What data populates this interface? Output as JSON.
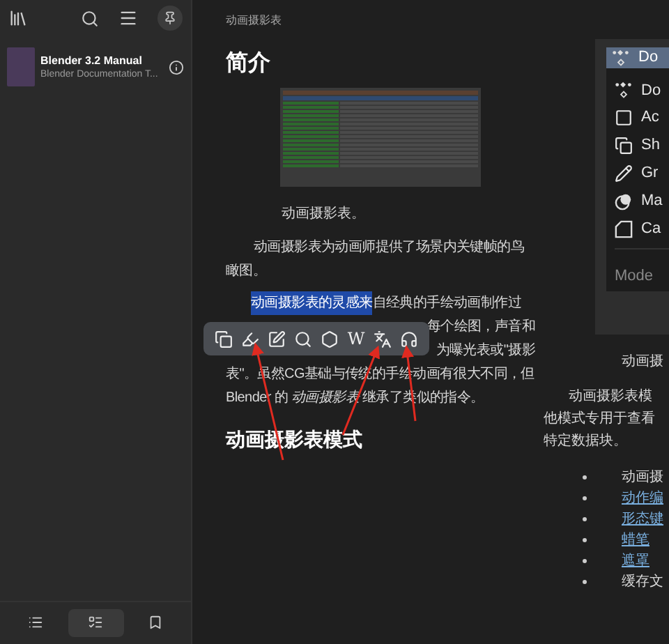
{
  "sidebar": {
    "book": {
      "title": "Blender 3.2 Manual",
      "subtitle": "Blender Documentation T..."
    },
    "bottom_tabs": [
      {
        "kind": "contents",
        "selected": false
      },
      {
        "kind": "notes",
        "selected": true
      },
      {
        "kind": "bookmarks",
        "selected": false
      }
    ]
  },
  "article": {
    "breadcrumb": "动画摄影表",
    "heading": "简介",
    "figure_caption": "动画摄影表。",
    "paragraph_1": "动画摄影表为动画师提供了场景内关键帧的鸟瞰图。",
    "paragraph_2": {
      "selected_text": "动画摄影表的灵感来",
      "line_1_rest": "自经典的手绘动画制作过",
      "line_2_visible": "每个绘图，声音和",
      "line_3_visible": "为曝光表或\"摄影",
      "line_4": "表\"。虽然CG基础与传统的手绘动画有很大不同，但",
      "line_5": "Blender 的 *动画摄影表* 继承了类似的指令。"
    },
    "selection_toolbar": [
      {
        "kind": "copy"
      },
      {
        "kind": "highlight"
      },
      {
        "kind": "note"
      },
      {
        "kind": "search"
      },
      {
        "kind": "hexagon"
      },
      {
        "kind": "wiki",
        "text": "W"
      },
      {
        "kind": "translate"
      },
      {
        "kind": "listen"
      }
    ],
    "heading_2": "动画摄影表模式"
  },
  "right_panel": {
    "menu_header": "Do",
    "menu_items": [
      {
        "kind": "dopesheet",
        "label": "Do"
      },
      {
        "kind": "action",
        "label": "Ac"
      },
      {
        "kind": "shape",
        "label": "Sh"
      },
      {
        "kind": "pencil",
        "label": "Gr"
      },
      {
        "kind": "mask",
        "label": "Ma"
      },
      {
        "kind": "cache",
        "label": "Ca"
      }
    ],
    "menu_footer": "Mode",
    "caption": "动画摄",
    "paragraph_lines": [
      "动画摄影表模",
      "他模式专用于查看",
      "特定数据块。"
    ],
    "bullets": [
      {
        "text": "动画摄",
        "link": false
      },
      {
        "text": "动作编",
        "link": true
      },
      {
        "text": "形态键",
        "link": true
      },
      {
        "text": "蜡笔",
        "link": true
      },
      {
        "text": "遮罩",
        "link": true
      },
      {
        "text": "缓存文",
        "link": false
      }
    ]
  }
}
